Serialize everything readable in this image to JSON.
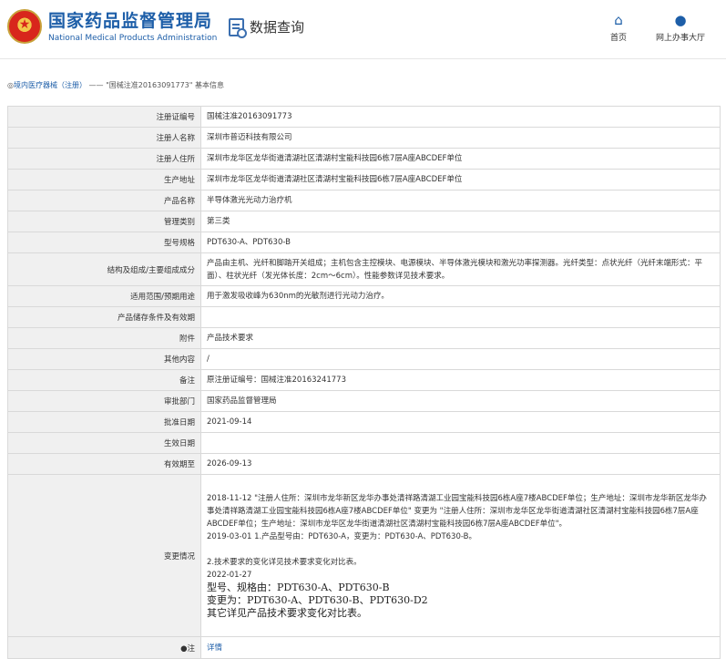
{
  "header": {
    "logo_cn": "国家药品监督管理局",
    "logo_en": "National Medical Products Administration",
    "query_label": "数据查询",
    "nav": [
      {
        "label": "首页",
        "icon": "home-icon"
      },
      {
        "label": "网上办事大厅",
        "icon": "user-icon"
      }
    ]
  },
  "breadcrumb": {
    "prefix": "◎",
    "link": "境内医疗器械（注册）",
    "sep": "——",
    "current": "\"国械注准20163091773\" 基本信息"
  },
  "rows": [
    {
      "label": "注册证编号",
      "value": "国械注准20163091773"
    },
    {
      "label": "注册人名称",
      "value": "深圳市普迈科技有限公司"
    },
    {
      "label": "注册人住所",
      "value": "深圳市龙华区龙华街道清湖社区清湖村宝能科技园6栋7层A座ABCDEF单位"
    },
    {
      "label": "生产地址",
      "value": "深圳市龙华区龙华街道清湖社区清湖村宝能科技园6栋7层A座ABCDEF单位"
    },
    {
      "label": "产品名称",
      "value": "半导体激光光动力治疗机"
    },
    {
      "label": "管理类别",
      "value": "第三类"
    },
    {
      "label": "型号规格",
      "value": "PDT630-A、PDT630-B"
    },
    {
      "label": "结构及组成/主要组成成分",
      "value": "产品由主机、光纤和脚踏开关组成；主机包含主控模块、电源模块、半导体激光模块和激光功率探测器。光纤类型：点状光纤（光纤末端形式：平面）、柱状光纤（发光体长度：2cm～6cm）。性能参数详见技术要求。"
    },
    {
      "label": "适用范围/预期用途",
      "value": "用于激发吸收峰为630nm的光敏剂进行光动力治疗。"
    },
    {
      "label": "产品储存条件及有效期",
      "value": ""
    },
    {
      "label": "附件",
      "value": "产品技术要求"
    },
    {
      "label": "其他内容",
      "value": "/"
    },
    {
      "label": "备注",
      "value": "原注册证编号：国械注准20163241773"
    },
    {
      "label": "审批部门",
      "value": "国家药品监督管理局"
    },
    {
      "label": "批准日期",
      "value": "2021-09-14"
    },
    {
      "label": "生效日期",
      "value": ""
    },
    {
      "label": "有效期至",
      "value": "2026-09-13"
    }
  ],
  "changes": {
    "label": "变更情况",
    "line1": "2018-11-12 \"注册人住所：深圳市龙华新区龙华办事处清祥路清湖工业园宝能科技园6栋A座7楼ABCDEF单位；生产地址：深圳市龙华新区龙华办事处清祥路清湖工业园宝能科技园6栋A座7楼ABCDEF单位\" 变更为 \"注册人住所：深圳市龙华区龙华街道清湖社区清湖村宝能科技园6栋7层A座ABCDEF单位；生产地址：深圳市龙华区龙华街道清湖社区清湖村宝能科技园6栋7层A座ABCDEF单位\"。",
    "line2": "2019-03-01 1.产品型号由：PDT630-A，变更为：PDT630-A、PDT630-B。",
    "line3": "2.技术要求的变化详见技术要求变化对比表。",
    "line4": "2022-01-27",
    "line5": "型号、规格由：PDT630-A、PDT630-B",
    "line6": "变更为：PDT630-A、PDT630-B、PDT630-D2",
    "line7": "其它详见产品技术要求变化对比表。"
  },
  "note": {
    "label": "●注",
    "value": "详情"
  }
}
